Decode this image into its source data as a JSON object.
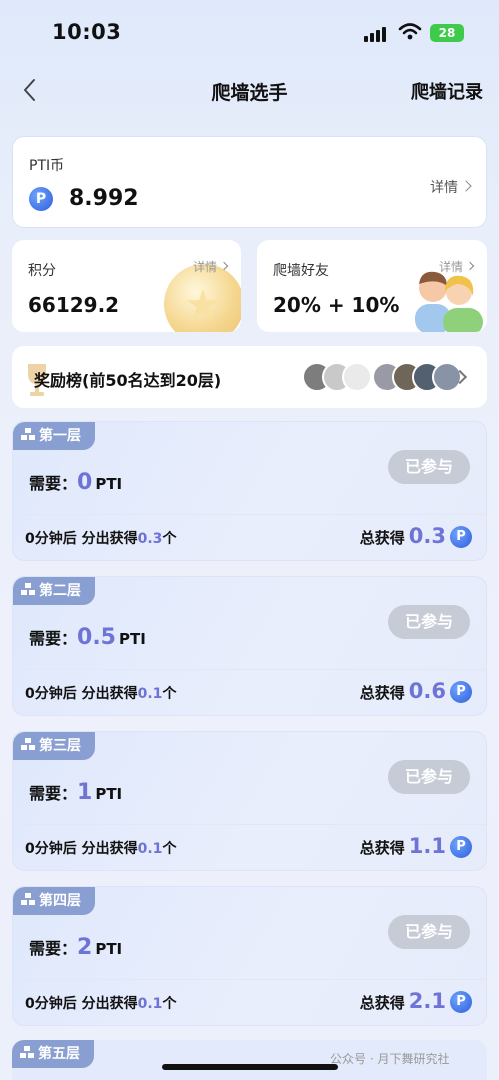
{
  "status": {
    "time": "10:03",
    "battery": "28"
  },
  "nav": {
    "title": "爬墙选手",
    "right": "爬墙记录"
  },
  "pti": {
    "label": "PTI币",
    "coin_glyph": "P",
    "value": "8.992",
    "detail": "详情"
  },
  "score": {
    "label": "积分",
    "value": "66129.2",
    "detail": "详情"
  },
  "friends": {
    "label": "爬墙好友",
    "value": "20% + 10%",
    "detail": "详情"
  },
  "leaderboard": {
    "title": "奖励榜(前50名达到20层)"
  },
  "levels": [
    {
      "name": "第一层",
      "need_label": "需要：",
      "need": "0",
      "unit": "PTI",
      "button": "已参与",
      "dist_prefix": "0分钟后 分出获得",
      "dist": "0.3",
      "dist_suffix": "个",
      "total_label": "总获得",
      "total": "0.3"
    },
    {
      "name": "第二层",
      "need_label": "需要：",
      "need": "0.5",
      "unit": "PTI",
      "button": "已参与",
      "dist_prefix": "0分钟后 分出获得",
      "dist": "0.1",
      "dist_suffix": "个",
      "total_label": "总获得",
      "total": "0.6"
    },
    {
      "name": "第三层",
      "need_label": "需要：",
      "need": "1",
      "unit": "PTI",
      "button": "已参与",
      "dist_prefix": "0分钟后 分出获得",
      "dist": "0.1",
      "dist_suffix": "个",
      "total_label": "总获得",
      "total": "1.1"
    },
    {
      "name": "第四层",
      "need_label": "需要：",
      "need": "2",
      "unit": "PTI",
      "button": "已参与",
      "dist_prefix": "0分钟后 分出获得",
      "dist": "0.1",
      "dist_suffix": "个",
      "total_label": "总获得",
      "total": "2.1"
    },
    {
      "name": "第五层"
    }
  ],
  "watermark": "公众号 · 月下舞研究社",
  "colors": {
    "accent": "#6d74d6",
    "tag": "#8a9fd1",
    "joined": "#c7cbd6",
    "coin": "#2e5fd8"
  }
}
